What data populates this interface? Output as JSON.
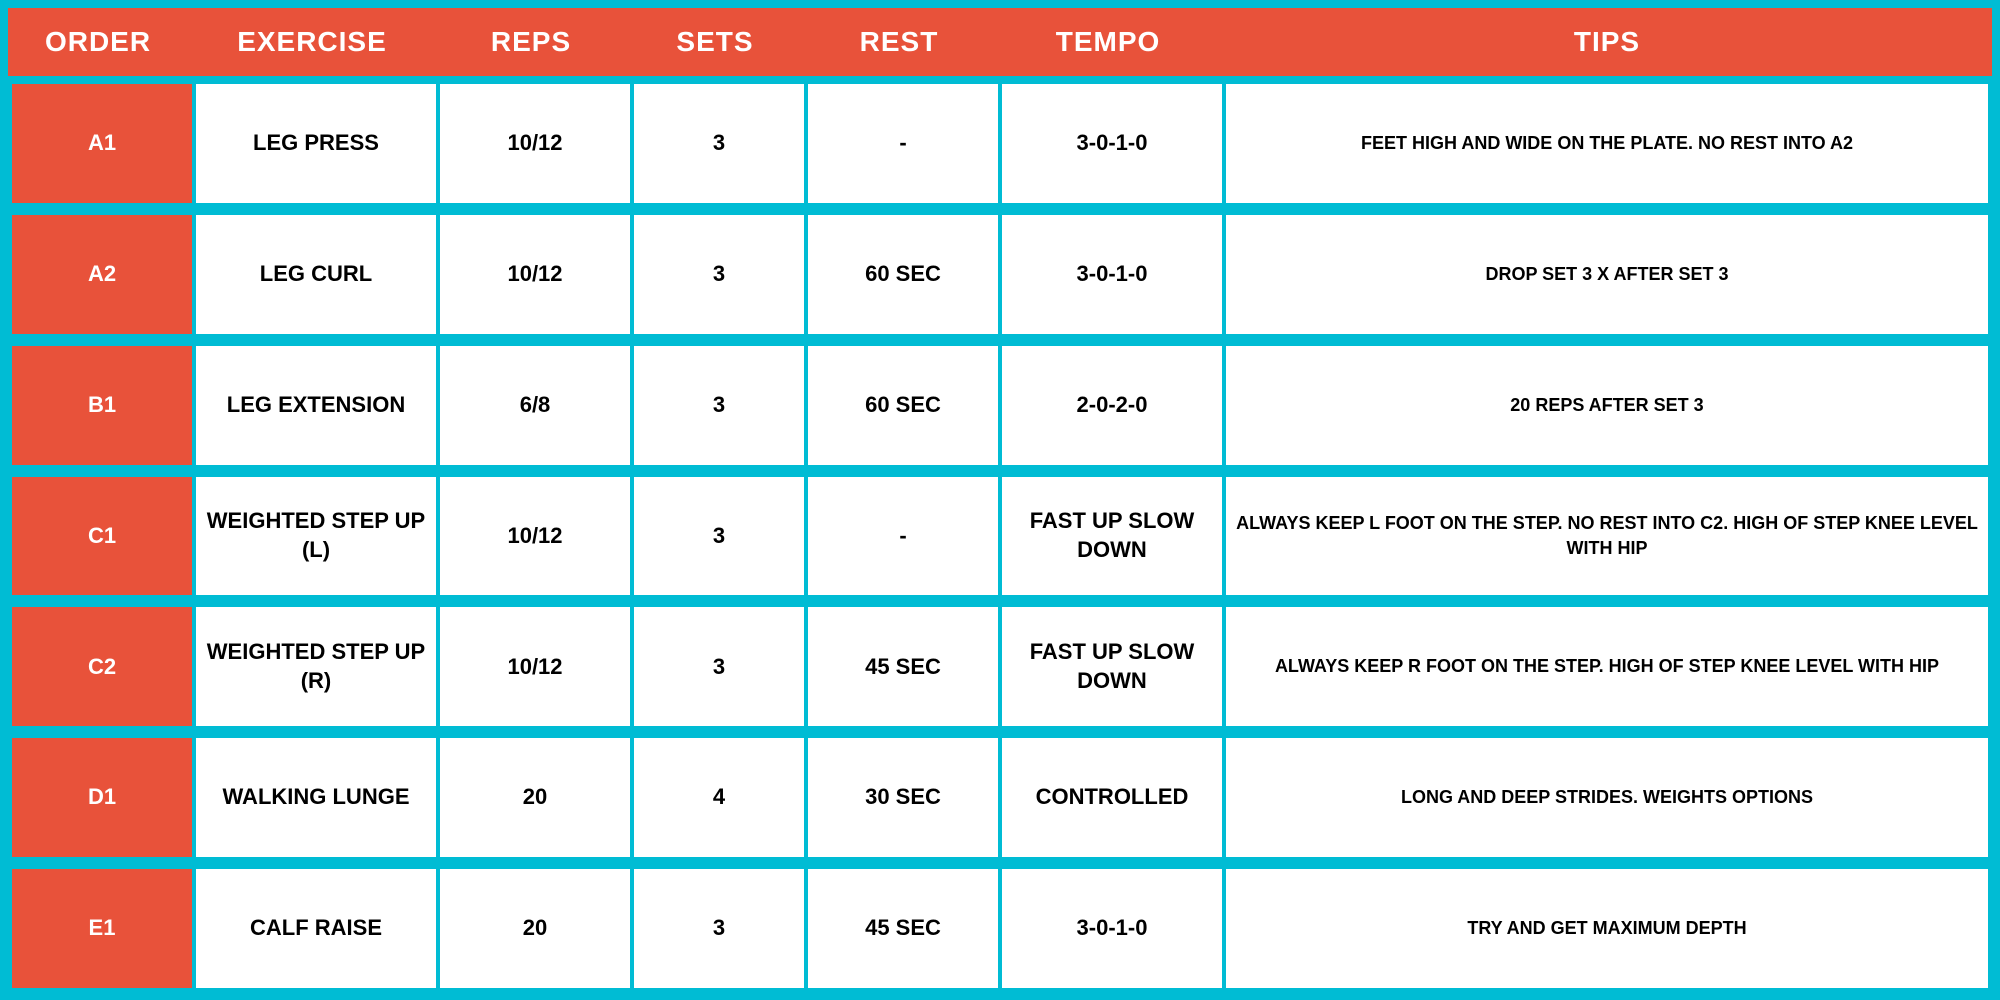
{
  "header": {
    "order": "ORDER",
    "exercise": "EXERCISE",
    "reps": "REPS",
    "sets": "SETS",
    "rest": "REST",
    "tempo": "TEMPO",
    "tips": "TIPS"
  },
  "rows": [
    {
      "order": "A1",
      "exercise": "LEG PRESS",
      "reps": "10/12",
      "sets": "3",
      "rest": "-",
      "tempo": "3-0-1-0",
      "tips": "FEET HIGH AND WIDE ON THE PLATE. NO REST INTO A2"
    },
    {
      "order": "A2",
      "exercise": "LEG CURL",
      "reps": "10/12",
      "sets": "3",
      "rest": "60 SEC",
      "tempo": "3-0-1-0",
      "tips": "DROP SET 3  X AFTER SET 3"
    },
    {
      "order": "B1",
      "exercise": "LEG EXTENSION",
      "reps": "6/8",
      "sets": "3",
      "rest": "60 SEC",
      "tempo": "2-0-2-0",
      "tips": "20 REPS AFTER SET 3"
    },
    {
      "order": "C1",
      "exercise": "WEIGHTED STEP UP (L)",
      "reps": "10/12",
      "sets": "3",
      "rest": "-",
      "tempo": "FAST UP SLOW DOWN",
      "tips": "ALWAYS KEEP L FOOT ON THE STEP. NO REST INTO C2. HIGH OF STEP KNEE LEVEL WITH HIP"
    },
    {
      "order": "C2",
      "exercise": "WEIGHTED STEP UP (R)",
      "reps": "10/12",
      "sets": "3",
      "rest": "45 SEC",
      "tempo": "FAST UP SLOW DOWN",
      "tips": "ALWAYS KEEP R FOOT ON THE STEP. HIGH OF STEP KNEE LEVEL WITH HIP"
    },
    {
      "order": "D1",
      "exercise": "WALKING LUNGE",
      "reps": "20",
      "sets": "4",
      "rest": "30 SEC",
      "tempo": "CONTROLLED",
      "tips": "LONG AND DEEP STRIDES. WEIGHTS OPTIONS"
    },
    {
      "order": "E1",
      "exercise": "CALF RAISE",
      "reps": "20",
      "sets": "3",
      "rest": "45 SEC",
      "tempo": "3-0-1-0",
      "tips": "TRY AND GET MAXIMUM DEPTH"
    }
  ]
}
